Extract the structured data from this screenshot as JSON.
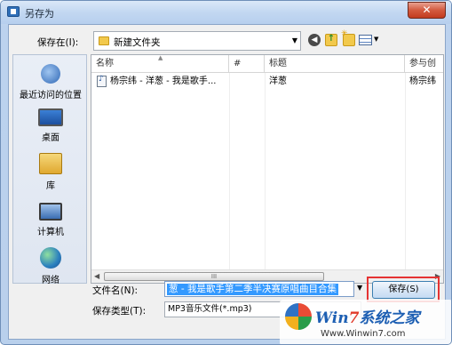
{
  "window": {
    "title": "另存为",
    "close_label": "✕"
  },
  "save_in": {
    "label": "保存在(I):",
    "value": "新建文件夹"
  },
  "places": [
    {
      "label": "最近访问的位置"
    },
    {
      "label": "桌面"
    },
    {
      "label": "库"
    },
    {
      "label": "计算机"
    },
    {
      "label": "网络"
    }
  ],
  "file_list": {
    "columns": [
      "名称",
      "#",
      "标题",
      "参与创"
    ],
    "rows": [
      {
        "name": "杨宗纬 - 洋葱 - 我是歌手...",
        "track": "",
        "title": "洋葱",
        "artist": "杨宗纬"
      }
    ],
    "scroll_thumb_glyph": "III"
  },
  "form": {
    "filename_label": "文件名(N):",
    "filename_value": "葱 - 我是歌手第二季半决赛原唱曲目合集",
    "type_label": "保存类型(T):",
    "type_value": "MP3音乐文件(*.mp3)",
    "save_button": "保存(S)"
  },
  "watermark": {
    "brand_a": "Win",
    "brand_b": "7",
    "brand_c": "系统之家",
    "url": "Www.Winwin7.com"
  },
  "colors": {
    "selection": "#3399ff",
    "highlight_frame": "#e53333",
    "titlebar": "#c2d7f1"
  }
}
